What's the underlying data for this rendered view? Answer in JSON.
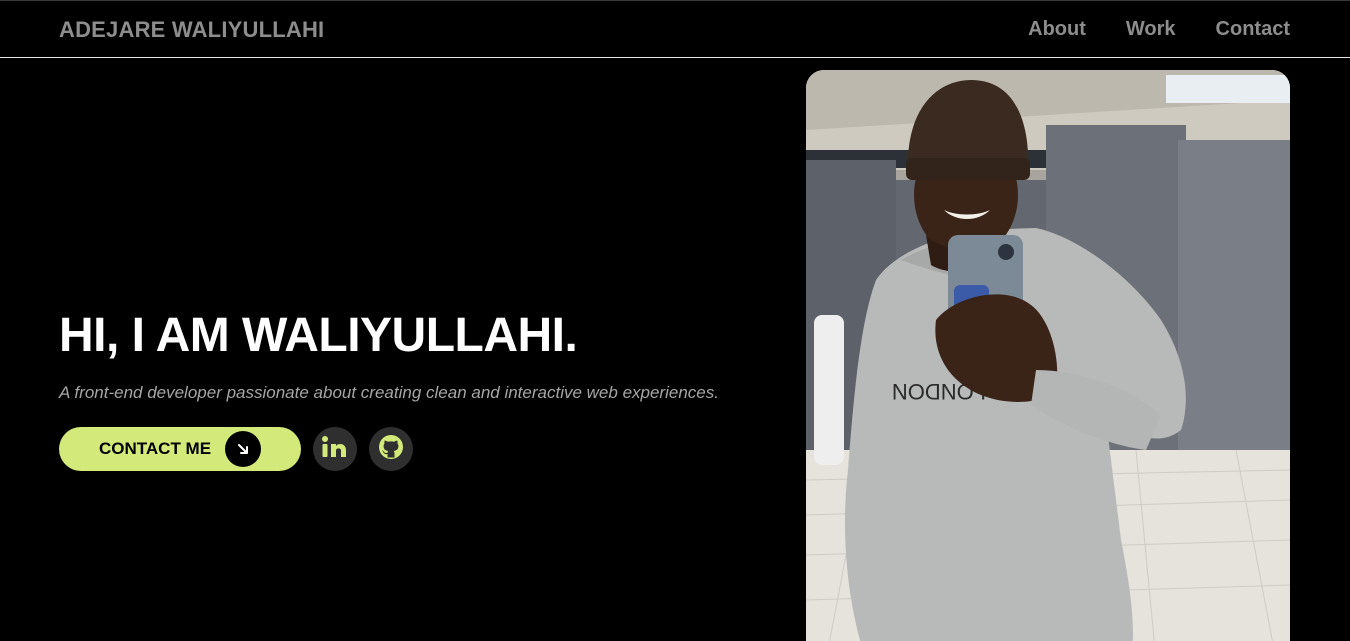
{
  "header": {
    "brand": "ADEJARE WALIYULLAHI",
    "nav": [
      "About",
      "Work",
      "Contact"
    ]
  },
  "hero": {
    "title": "HI, I AM WALIYULLAHI.",
    "subtitle": "A front-end developer passionate about creating clean and interactive web experiences.",
    "cta_label": "CONTACT ME",
    "cta_icon": "arrow-down-right-icon",
    "socials": [
      {
        "icon": "linkedin-icon"
      },
      {
        "icon": "github-icon"
      }
    ]
  },
  "colors": {
    "background": "#000000",
    "accent": "#d3e97a",
    "muted_text": "#8d8d8d",
    "icon_bg": "#2f2f2f"
  }
}
